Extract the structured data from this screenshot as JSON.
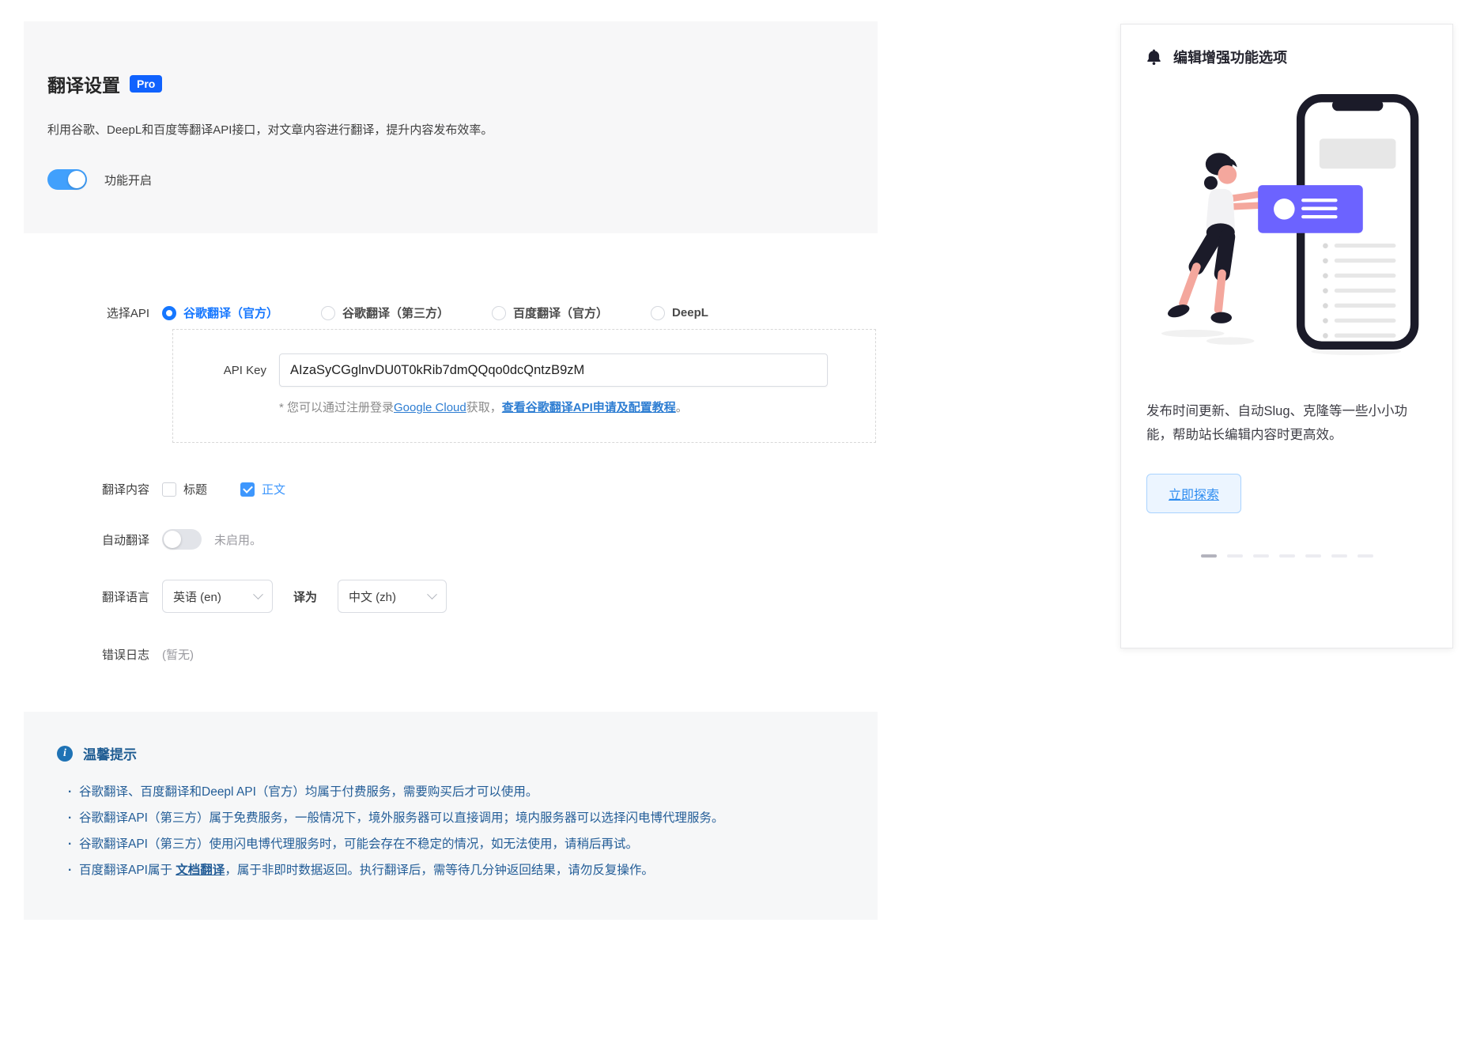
{
  "main": {
    "header": {
      "title": "翻译设置",
      "badge": "Pro",
      "description": "利用谷歌、DeepL和百度等翻译API接口，对文章内容进行翻译，提升内容发布效率。",
      "feature_toggle_label": "功能开启",
      "feature_toggle_state": "on"
    },
    "form": {
      "api_select_label": "选择API",
      "api_options": [
        {
          "label": "谷歌翻译（官方）",
          "selected": true
        },
        {
          "label": "谷歌翻译（第三方）",
          "selected": false
        },
        {
          "label": "百度翻译（官方）",
          "selected": false
        },
        {
          "label": "DeepL",
          "selected": false
        }
      ],
      "api_key": {
        "label": "API Key",
        "value": "AIzaSyCGglnvDU0T0kRib7dmQQqo0dcQntzB9zM"
      },
      "api_help": {
        "prefix": "* 您可以通过注册登录",
        "link1": "Google Cloud",
        "middle": "获取，",
        "link2": "查看谷歌翻译API申请及配置教程",
        "suffix": "。"
      },
      "content_row": {
        "label": "翻译内容",
        "checkboxes": [
          {
            "label": "标题",
            "checked": false
          },
          {
            "label": "正文",
            "checked": true
          }
        ]
      },
      "auto_row": {
        "label": "自动翻译",
        "toggle_state": "off",
        "status": "未启用。"
      },
      "language_row": {
        "label": "翻译语言",
        "from_value": "英语 (en)",
        "to_label": "译为",
        "to_value": "中文 (zh)"
      },
      "log_row": {
        "label": "错误日志",
        "value": "(暂无)"
      }
    },
    "tips": {
      "title": "温馨提示",
      "items": [
        "谷歌翻译、百度翻译和Deepl API（官方）均属于付费服务，需要购买后才可以使用。",
        "谷歌翻译API（第三方）属于免费服务，一般情况下，境外服务器可以直接调用；境内服务器可以选择闪电博代理服务。",
        "谷歌翻译API（第三方）使用闪电博代理服务时，可能会存在不稳定的情况，如无法使用，请稍后再试。"
      ],
      "last_item": {
        "prefix": "百度翻译API属于 ",
        "link": "文档翻译",
        "suffix": "，属于非即时数据返回。执行翻译后，需等待几分钟返回结果，请勿反复操作。"
      }
    }
  },
  "promo_card": {
    "title": "编辑增强功能选项",
    "body": "发布时间更新、自动Slug、克隆等一些小小功能，帮助站长编辑内容时更高效。",
    "button_label": "立即探索",
    "carousel": {
      "dot_count": 7,
      "active_index": 0
    }
  },
  "icons": {
    "bell": "bell-icon",
    "info": "info-icon",
    "chevron_down": "chevron-down-icon",
    "check": "check-icon"
  },
  "colors": {
    "accent_blue": "#1677ff",
    "checkbox_blue": "#3e97fd",
    "toggle_on_blue": "#41a0fc",
    "badge_blue": "#1062fe",
    "link_blue": "#2d7dd2",
    "tips_text_blue": "#235d97",
    "tips_icon_blue": "#1f73b5",
    "button_text_blue": "#2d8cf0",
    "button_bg": "#ecf5ff",
    "illustration_purple": "#6c63ff",
    "illustration_dark": "#1b1b29",
    "illustration_skin": "#f4a79d",
    "section_bg": "#f7f7f8"
  }
}
